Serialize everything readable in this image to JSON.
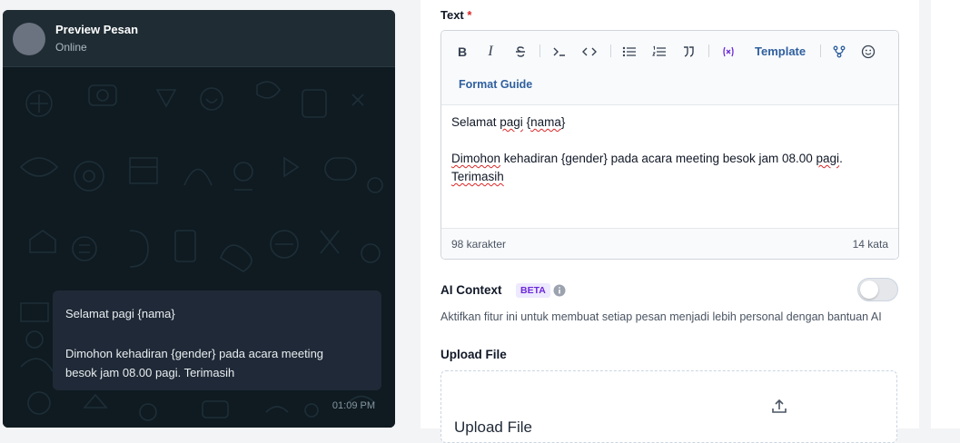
{
  "preview": {
    "contact_name": "Preview Pesan",
    "status": "Online",
    "message_lines": [
      "Selamat pagi {nama}",
      "",
      "Dimohon kehadiran {gender} pada acara meeting",
      "besok jam 08.00 pagi. Terimasih"
    ],
    "time": "01:09 PM"
  },
  "form": {
    "text_label": "Text",
    "required_mark": "*",
    "toolbar": {
      "bold": "B",
      "italic": "I",
      "template_label": "Template",
      "format_guide_label": "Format Guide"
    },
    "editor_lines": [
      "Selamat pagi {nama}",
      "",
      "Dimohon kehadiran {gender} pada acara meeting besok jam 08.00 pagi.",
      "Terimasih"
    ],
    "char_count": "98 karakter",
    "word_count": "14 kata",
    "ai_context": {
      "label": "AI Context",
      "badge": "BETA",
      "enabled": false,
      "description": "Aktifkan fitur ini untuk membuat setiap pesan menjadi lebih personal dengan bantuan AI"
    },
    "upload": {
      "label": "Upload File",
      "dropzone_title": "Upload File"
    }
  },
  "colors": {
    "chat_bg": "#0f1b21",
    "bubble": "#1f2937",
    "link_blue": "#2f5f9e",
    "required_red": "#dc2626",
    "beta_purple": "#6d28d9"
  }
}
